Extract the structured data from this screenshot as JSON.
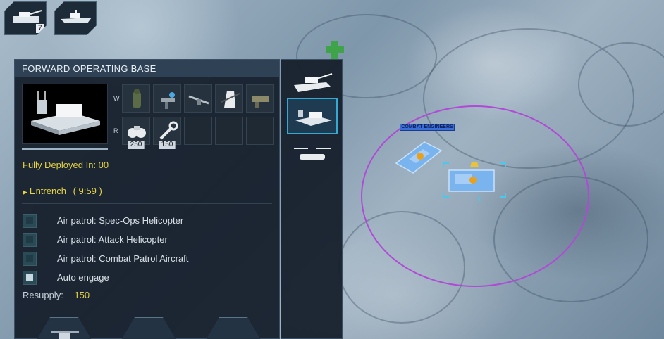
{
  "top_cards": [
    {
      "icon": "light-tank-icon",
      "count": "7"
    },
    {
      "icon": "warship-icon",
      "count": ""
    }
  ],
  "panel": {
    "title": "FORWARD OPERATING BASE",
    "weapon_row_label": "W",
    "resource_row_label": "R",
    "weapon_slots": [
      "soldier-icon",
      "turret-gunner-icon",
      "rifle-icon",
      "sniper-icon",
      "gatling-gun-icon"
    ],
    "resource_slots": [
      {
        "icon": "binoculars-icon",
        "count": "250"
      },
      {
        "icon": "wrench-icon",
        "count": "150"
      },
      {
        "icon": "",
        "count": ""
      },
      {
        "icon": "",
        "count": ""
      },
      {
        "icon": "",
        "count": ""
      }
    ],
    "deployed_text": "Fully Deployed In: 00",
    "entrench_label": "Entrench",
    "entrench_time": "( 9:59 )",
    "options": [
      {
        "label": "Air patrol: Spec-Ops Helicopter",
        "checked": false
      },
      {
        "label": "Air patrol: Attack Helicopter",
        "checked": false
      },
      {
        "label": "Air patrol: Combat Patrol Aircraft",
        "checked": false
      },
      {
        "label": "Auto engage",
        "checked": true
      }
    ],
    "resupply_label": "Resupply:",
    "resupply_value": "150"
  },
  "side_units": [
    {
      "icon": "tank-icon",
      "selected": false
    },
    {
      "icon": "forward-operating-base-icon",
      "selected": true
    },
    {
      "icon": "tiltrotor-icon",
      "selected": false
    }
  ],
  "map": {
    "unit_label": "COMBAT ENGINEERS",
    "zone_color": "#b04ad6",
    "unit_color": "#7ab4ef"
  }
}
